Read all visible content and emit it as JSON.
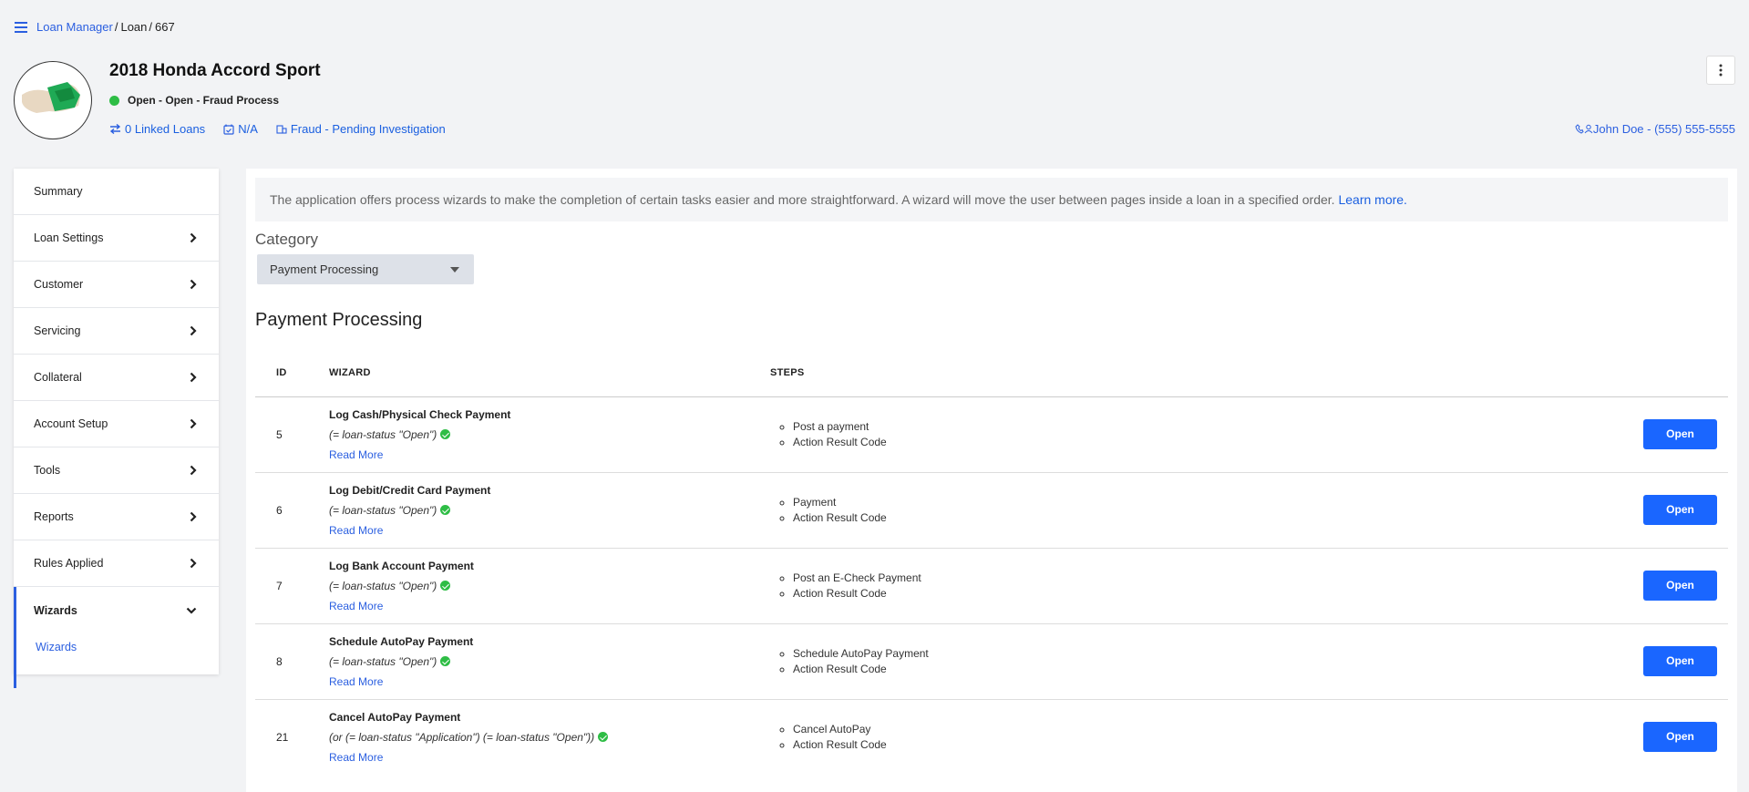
{
  "breadcrumb": {
    "items": [
      "Loan Manager",
      "Loan",
      "667"
    ]
  },
  "header": {
    "title": "2018 Honda Accord Sport",
    "status": "Open - Open - Fraud Process",
    "linked_loans": "0 Linked Loans",
    "date": "N/A",
    "portfolio": "Fraud - Pending Investigation",
    "contact": "John Doe - (555) 555-5555"
  },
  "sidebar": {
    "items": [
      {
        "label": "Summary",
        "chevron": false
      },
      {
        "label": "Loan Settings",
        "chevron": true
      },
      {
        "label": "Customer",
        "chevron": true
      },
      {
        "label": "Servicing",
        "chevron": true
      },
      {
        "label": "Collateral",
        "chevron": true
      },
      {
        "label": "Account Setup",
        "chevron": true
      },
      {
        "label": "Tools",
        "chevron": true
      },
      {
        "label": "Reports",
        "chevron": true
      },
      {
        "label": "Rules Applied",
        "chevron": true
      }
    ],
    "active": {
      "label": "Wizards",
      "sub": "Wizards"
    }
  },
  "main": {
    "info_text": "The application offers process wizards to make the completion of certain tasks easier and more straightforward. A wizard will move the user between pages inside a loan in a specified order.",
    "learn_more": "Learn more.",
    "category_label": "Category",
    "category_value": "Payment Processing",
    "section_title": "Payment Processing",
    "columns": {
      "id": "ID",
      "wizard": "WIZARD",
      "steps": "STEPS"
    },
    "rows": [
      {
        "id": "5",
        "name": "Log Cash/Physical Check Payment",
        "condition": "(= loan-status \"Open\")",
        "read_more": "Read More",
        "steps": [
          "Post a payment",
          "Action Result Code"
        ],
        "action": "Open"
      },
      {
        "id": "6",
        "name": "Log Debit/Credit Card Payment",
        "condition": "(= loan-status \"Open\")",
        "read_more": "Read More",
        "steps": [
          "Payment",
          "Action Result Code"
        ],
        "action": "Open"
      },
      {
        "id": "7",
        "name": "Log Bank Account Payment",
        "condition": "(= loan-status \"Open\")",
        "read_more": "Read More",
        "steps": [
          "Post an E-Check Payment",
          "Action Result Code"
        ],
        "action": "Open"
      },
      {
        "id": "8",
        "name": "Schedule AutoPay Payment",
        "condition": "(= loan-status \"Open\")",
        "read_more": "Read More",
        "steps": [
          "Schedule AutoPay Payment",
          "Action Result Code"
        ],
        "action": "Open"
      },
      {
        "id": "21",
        "name": "Cancel AutoPay Payment",
        "condition": "(or (= loan-status \"Application\") (= loan-status \"Open\"))",
        "read_more": "Read More",
        "steps": [
          "Cancel AutoPay",
          "Action Result Code"
        ],
        "action": "Open"
      }
    ]
  }
}
